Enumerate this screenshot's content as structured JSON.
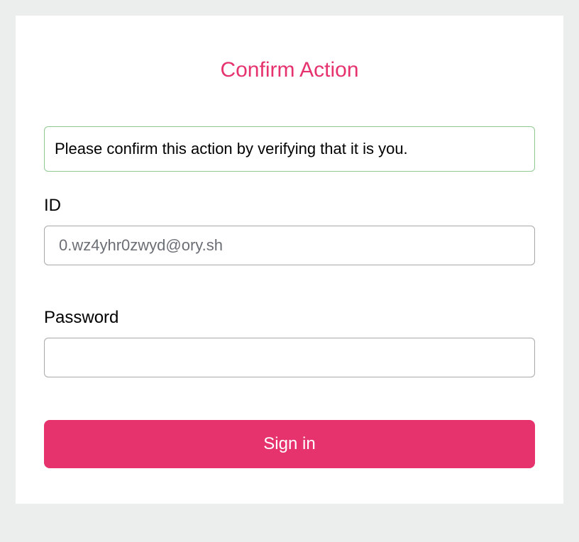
{
  "title": "Confirm Action",
  "message": "Please confirm this action by verifying that it is you.",
  "fields": {
    "id": {
      "label": "ID",
      "value": "0.wz4yhr0zwyd@ory.sh"
    },
    "password": {
      "label": "Password",
      "value": ""
    }
  },
  "submit": {
    "label": "Sign in"
  }
}
